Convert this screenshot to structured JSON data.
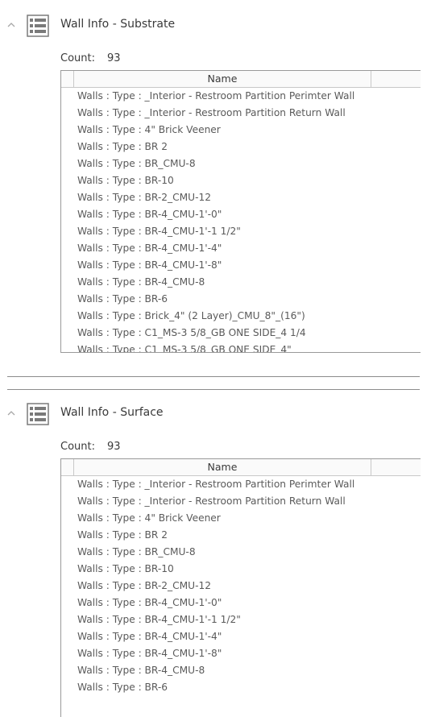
{
  "sections": [
    {
      "title": "Wall Info - Substrate",
      "count_label": "Count:",
      "count_value": "93",
      "column_header": "Name",
      "rows": [
        "Walls : Type : _Interior - Restroom Partition Perimter Wall",
        "Walls : Type : _Interior - Restroom Partition Return Wall",
        "Walls : Type : 4\" Brick Veener",
        "Walls : Type : BR 2",
        "Walls : Type : BR_CMU-8",
        "Walls : Type : BR-10",
        "Walls : Type : BR-2_CMU-12",
        "Walls : Type : BR-4_CMU-1'-0\"",
        "Walls : Type : BR-4_CMU-1'-1 1/2\"",
        "Walls : Type : BR-4_CMU-1'-4\"",
        "Walls : Type : BR-4_CMU-1'-8\"",
        "Walls : Type : BR-4_CMU-8",
        "Walls : Type : BR-6",
        "Walls : Type : Brick_4\" (2 Layer)_CMU_8\"_(16\")",
        "Walls : Type : C1_MS-3 5/8_GB ONE SIDE_4 1/4",
        "Walls : Type : C1_MS-3 5/8_GB ONE SIDE_4\""
      ]
    },
    {
      "title": "Wall Info - Surface",
      "count_label": "Count:",
      "count_value": "93",
      "column_header": "Name",
      "rows": [
        "Walls : Type : _Interior - Restroom Partition Perimter Wall",
        "Walls : Type : _Interior - Restroom Partition Return Wall",
        "Walls : Type : 4\" Brick Veener",
        "Walls : Type : BR 2",
        "Walls : Type : BR_CMU-8",
        "Walls : Type : BR-10",
        "Walls : Type : BR-2_CMU-12",
        "Walls : Type : BR-4_CMU-1'-0\"",
        "Walls : Type : BR-4_CMU-1'-1 1/2\"",
        "Walls : Type : BR-4_CMU-1'-4\"",
        "Walls : Type : BR-4_CMU-1'-8\"",
        "Walls : Type : BR-4_CMU-8",
        "Walls : Type : BR-6"
      ]
    }
  ],
  "icons": {
    "collapse": "chevron-up-icon",
    "list": "list-icon"
  }
}
